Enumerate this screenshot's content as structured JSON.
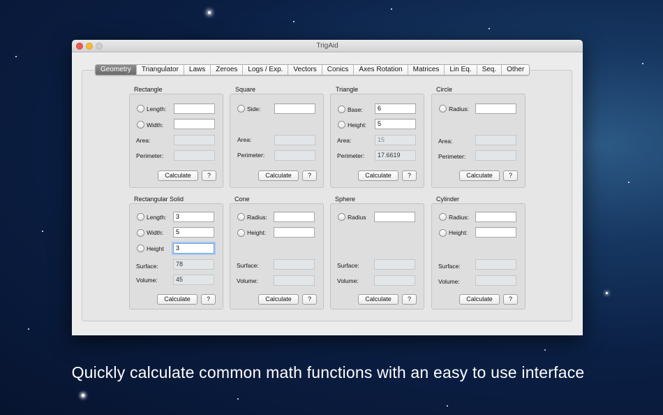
{
  "window": {
    "title": "TrigAid"
  },
  "tabs": [
    "Geometry",
    "Triangulator",
    "Laws",
    "Zeroes",
    "Logs / Exp.",
    "Vectors",
    "Conics",
    "Axes Rotation",
    "Matrices",
    "Lin Eq.",
    "Seq.",
    "Other"
  ],
  "active_tab": "Geometry",
  "calc_label": "Calculate",
  "help_label": "?",
  "rectangle": {
    "title": "Rectangle",
    "length_label": "Length:",
    "width_label": "Width:",
    "area_label": "Area:",
    "perimeter_label": "Perimeter:",
    "length": "",
    "width": "",
    "area": "",
    "perimeter": ""
  },
  "square": {
    "title": "Square",
    "side_label": "Side:",
    "area_label": "Area:",
    "perimeter_label": "Perimeter:",
    "side": "",
    "area": "",
    "perimeter": ""
  },
  "triangle": {
    "title": "Triangle",
    "base_label": "Base:",
    "height_label": "Height:",
    "area_label": "Area:",
    "perimeter_label": "Perimeter:",
    "base": "6",
    "height": "5",
    "area": "15",
    "perimeter": "17.6619"
  },
  "circle": {
    "title": "Circle",
    "radius_label": "Radius:",
    "area_label": "Area:",
    "perimeter_label": "Perimeter:",
    "radius": "",
    "area": "",
    "perimeter": ""
  },
  "rect_solid": {
    "title": "Rectangular Solid",
    "length_label": "Length:",
    "width_label": "Width:",
    "height_label": "Height",
    "surface_label": "Surface:",
    "volume_label": "Volume:",
    "length": "3",
    "width": "5",
    "height": "3",
    "surface": "78",
    "volume": "45"
  },
  "cone": {
    "title": "Cone",
    "radius_label": "Radius:",
    "height_label": "Height:",
    "surface_label": "Surface:",
    "volume_label": "Volume:",
    "radius": "",
    "height": "",
    "surface": "",
    "volume": ""
  },
  "sphere": {
    "title": "Sphere",
    "radius_label": "Radius",
    "surface_label": "Surface:",
    "volume_label": "Volume:",
    "radius": "",
    "surface": "",
    "volume": ""
  },
  "cylinder": {
    "title": "Cylinder",
    "radius_label": "Radius:",
    "height_label": "Height:",
    "surface_label": "Surface:",
    "volume_label": "Volume:",
    "radius": "",
    "height": "",
    "surface": "",
    "volume": ""
  },
  "caption": "Quickly calculate common math functions with an easy to use interface"
}
